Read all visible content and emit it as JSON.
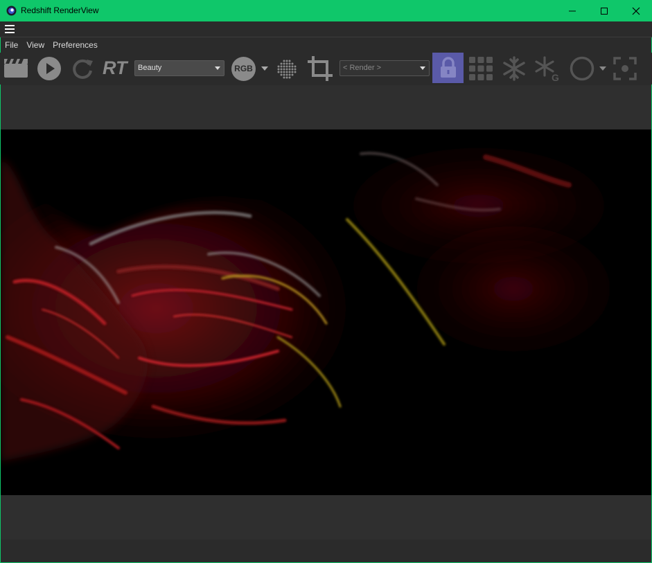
{
  "window": {
    "title": "Redshift RenderView",
    "titlebar_color": "#0fc76a"
  },
  "menu": {
    "items": [
      "File",
      "View",
      "Preferences"
    ]
  },
  "toolbar": {
    "aov_select": "Beauty",
    "rt_label": "RT",
    "rgb_label": "RGB",
    "snapshot_select": "< Render >",
    "lock_active_color": "#5a5aa8",
    "icons": [
      "clapboard-icon",
      "play-icon",
      "refresh-icon",
      "rt-icon",
      "rgb-icon",
      "dots-grid-icon",
      "crop-icon",
      "lock-icon",
      "grid-icon",
      "snowflake-icon",
      "snowflake-g-icon",
      "circle-icon",
      "focus-icon"
    ]
  }
}
